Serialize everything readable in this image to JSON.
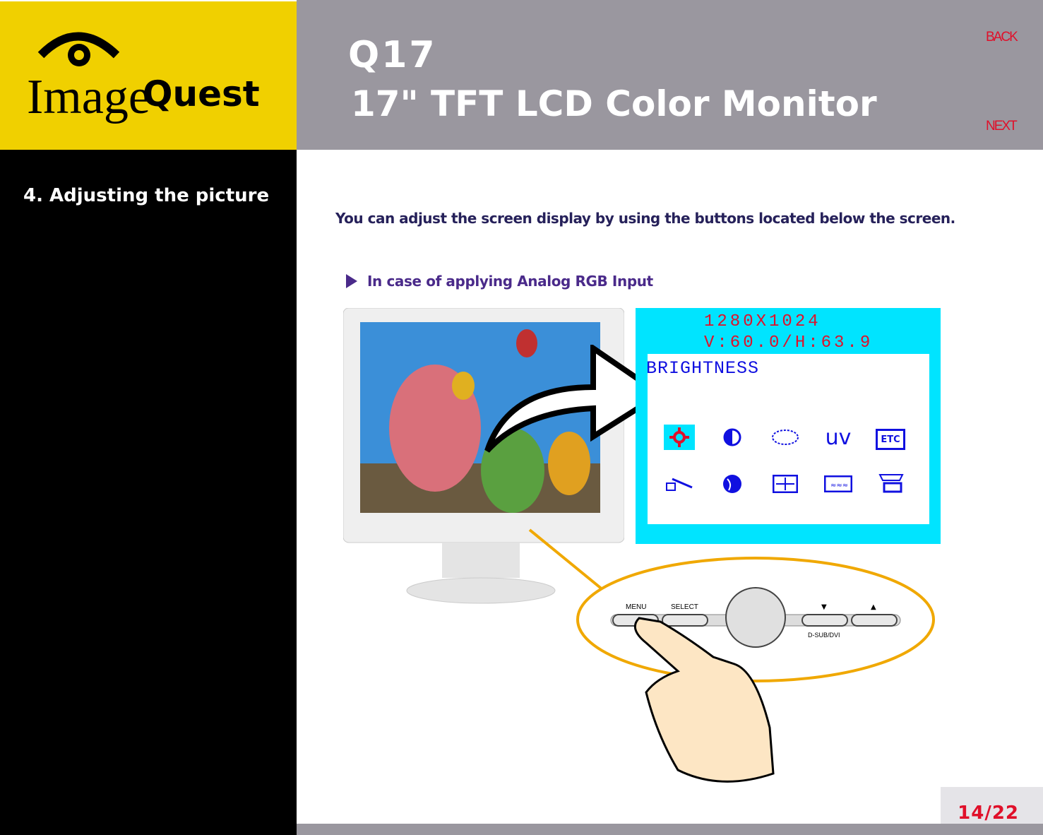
{
  "brand": {
    "logo_text_regular": "Image",
    "logo_text_bold": "Quest"
  },
  "header": {
    "model": "Q17",
    "title": "17\" TFT LCD Color Monitor",
    "back_label": "BACK",
    "next_label": "NEXT"
  },
  "sidebar": {
    "section_title": "4. Adjusting the picture"
  },
  "main": {
    "intro": "You can adjust the screen display by using the buttons located below the screen.",
    "subheading": "In case of applying Analog RGB Input",
    "osd": {
      "resolution": "1280X1024",
      "frequency": "V:60.0/H:63.9",
      "current_item": "BRIGHTNESS",
      "icons_row1": [
        "brightness-icon",
        "contrast-icon",
        "color-palette-icon",
        "uv-icon",
        "etc-icon"
      ],
      "icons_row2": [
        "degauss-icon",
        "language-icon",
        "position-icon",
        "phase-icon",
        "input-icon"
      ],
      "uv_text": "uv",
      "etc_text": "ETC",
      "accent_colors": {
        "background": "#00e4ff",
        "text_red": "#e0102a",
        "icon_blue": "#1010e0"
      }
    },
    "controls": {
      "menu_label": "MENU",
      "select_label": "SELECT",
      "down_label": "▼",
      "up_label": "▲",
      "input_label": "D-SUB/DVI"
    }
  },
  "footer": {
    "page_indicator": "14/22"
  }
}
